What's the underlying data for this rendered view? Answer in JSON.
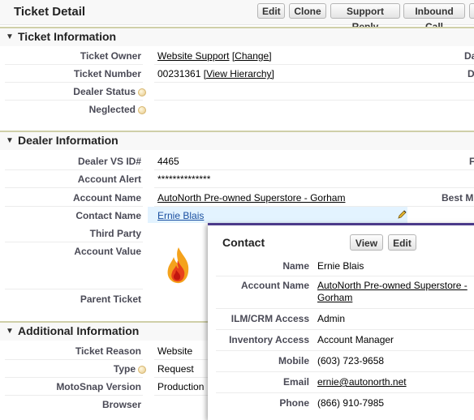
{
  "header": {
    "title": "Ticket Detail",
    "buttons": [
      "Edit",
      "Clone",
      "Support Reply",
      "Inbound Call",
      "C"
    ]
  },
  "sections": {
    "ticket_info": "Ticket Information",
    "dealer_info": "Dealer Information",
    "additional_info": "Additional Information"
  },
  "ticket": {
    "owner_label": "Ticket Owner",
    "owner_value": "Website Support",
    "owner_change": "[Change]",
    "number_label": "Ticket Number",
    "number_value": "00231361",
    "number_link": "[View Hierarchy]",
    "dealer_status_label": "Dealer Status",
    "neglected_label": "Neglected",
    "right_labels": [
      "Da",
      "D"
    ]
  },
  "dealer": {
    "vs_label": "Dealer VS ID#",
    "vs_value": "4465",
    "alert_label": "Account Alert",
    "alert_value": "**************",
    "account_label": "Account Name",
    "account_value": "AutoNorth Pre-owned Superstore - Gorham",
    "contact_label": "Contact Name",
    "contact_value": "Ernie Blais",
    "third_party_label": "Third Party",
    "account_value_label": "Account Value",
    "parent_label": "Parent Ticket",
    "right_labels": [
      "F",
      "Best M"
    ]
  },
  "additional": {
    "reason_label": "Ticket Reason",
    "reason_value": "Website",
    "type_label": "Type",
    "type_value": "Request",
    "motosnap_label": "MotoSnap Version",
    "motosnap_value": "Production",
    "browser_label": "Browser"
  },
  "popup": {
    "title": "Contact",
    "view_button": "View",
    "edit_button": "Edit",
    "fields": [
      {
        "label": "Name",
        "value": "Ernie Blais"
      },
      {
        "label": "Account Name",
        "value": "AutoNorth Pre-owned Superstore - Gorham"
      },
      {
        "label": "ILM/CRM Access",
        "value": "Admin"
      },
      {
        "label": "Inventory Access",
        "value": "Account Manager"
      },
      {
        "label": "Mobile",
        "value": "(603) 723-9658"
      },
      {
        "label": "Email",
        "value": "ernie@autonorth.net"
      },
      {
        "label": "Phone",
        "value": "(866) 910-7985"
      }
    ]
  },
  "colors": {
    "section_rule": "#cfcfa8",
    "popup_accent": "#4b3a8a",
    "hover_row": "#e3f3ff"
  }
}
